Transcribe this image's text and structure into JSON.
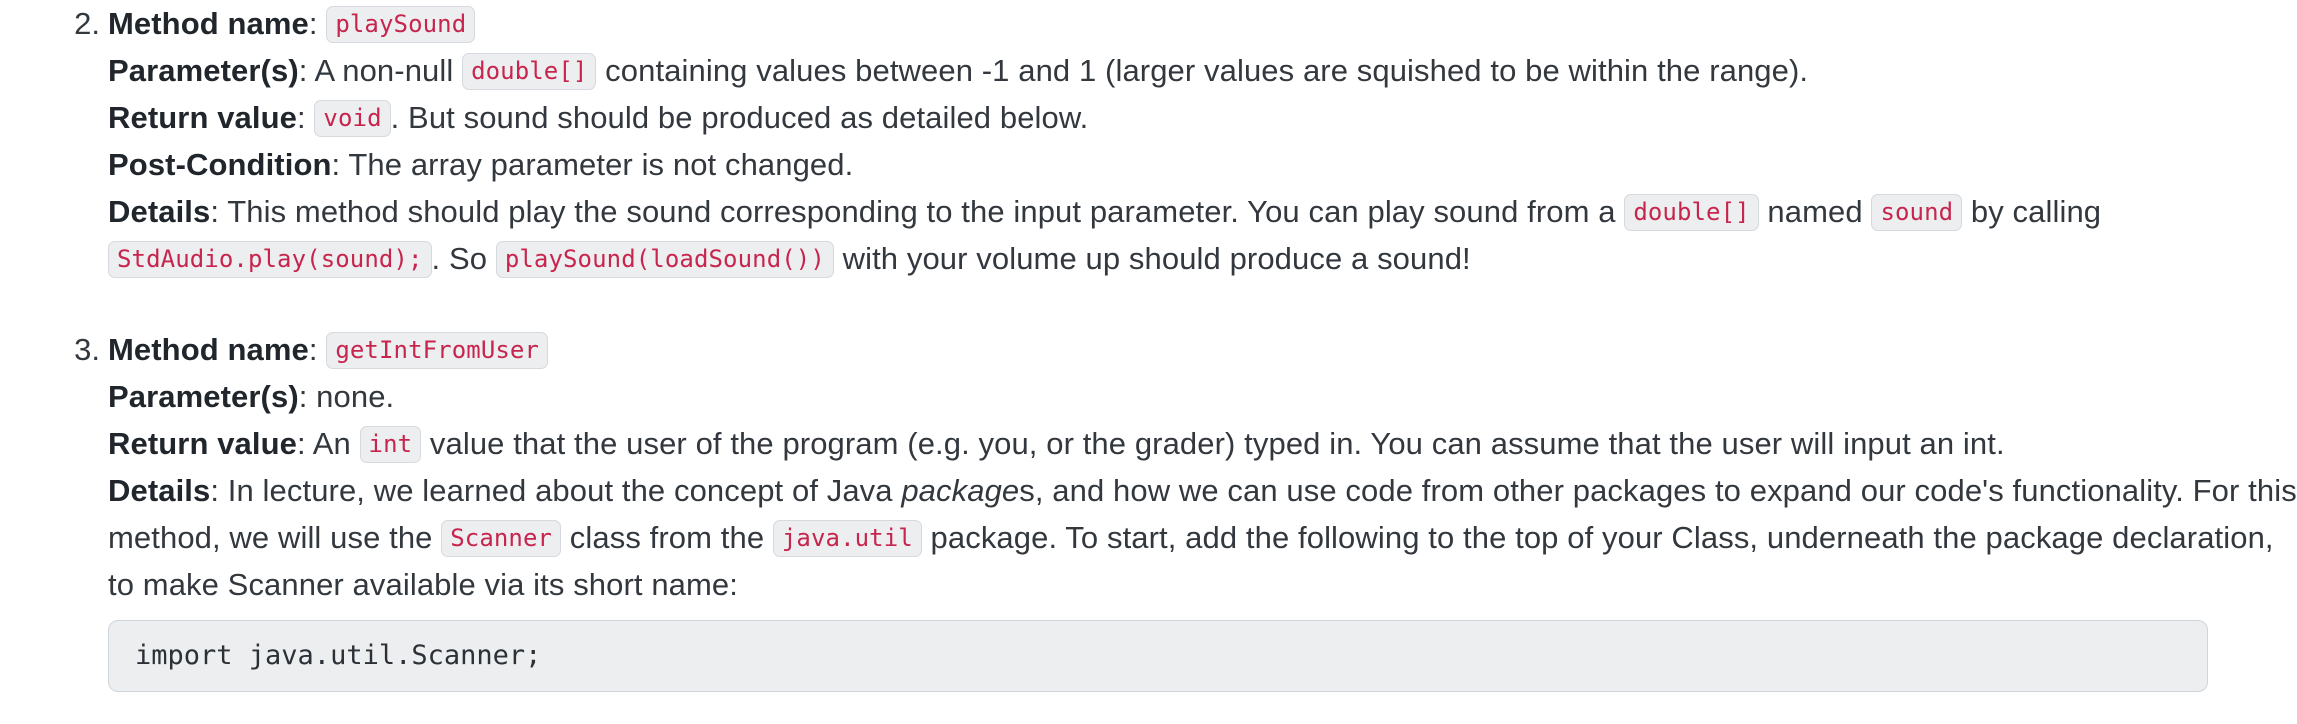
{
  "document": {
    "items": [
      {
        "number": "2.",
        "method_name_label": "Method name",
        "method_name_code": "playSound",
        "parameters_label": "Parameter(s)",
        "parameters_text_before": ": A non-null ",
        "parameters_code": "double[]",
        "parameters_text_after": " containing values between -1 and 1 (larger values are squished to be within the range).",
        "return_label": "Return value",
        "return_text_before": ": ",
        "return_code": "void",
        "return_text_after": ". But sound should be produced as detailed below.",
        "postcondition_label": "Post-Condition",
        "postcondition_text": ": The array parameter is not changed.",
        "details_label": "Details",
        "details_text_1": ": This method should play the sound corresponding to the input parameter. You can play sound from a ",
        "details_code_1": "double[]",
        "details_text_2": " named ",
        "details_code_2": "sound",
        "details_text_3": " by calling ",
        "details_code_3": "StdAudio.play(sound);",
        "details_text_4": ". So ",
        "details_code_4": "playSound(loadSound())",
        "details_text_5": " with your volume up should produce a sound!"
      },
      {
        "number": "3.",
        "method_name_label": "Method name",
        "method_name_code": "getIntFromUser",
        "parameters_label": "Parameter(s)",
        "parameters_text": ": none.",
        "return_label": "Return value",
        "return_text_before": ": An ",
        "return_code": "int",
        "return_text_after": " value that the user of the program (e.g. you, or the grader) typed in. You can assume that the user will input an int.",
        "details_label": "Details",
        "details_text_1": ": In lecture, we learned about the concept of Java ",
        "details_emphasis": "package",
        "details_text_2": "s, and how we can use code from other packages to expand our code's functionality. For this method, we will use the ",
        "details_code_1": "Scanner",
        "details_text_3": " class from the ",
        "details_code_2": "java.util",
        "details_text_4": " package. To start, add the following to the top of your Class, underneath the package declaration, to make Scanner available via its short name:",
        "code_block": "import java.util.Scanner;"
      }
    ]
  },
  "colors": {
    "text": "#32383e",
    "code_text": "#c7254e",
    "code_background": "#eceeef",
    "code_border": "#d6dade",
    "code_block_text": "#2b3137",
    "page_background": "#ffffff"
  }
}
